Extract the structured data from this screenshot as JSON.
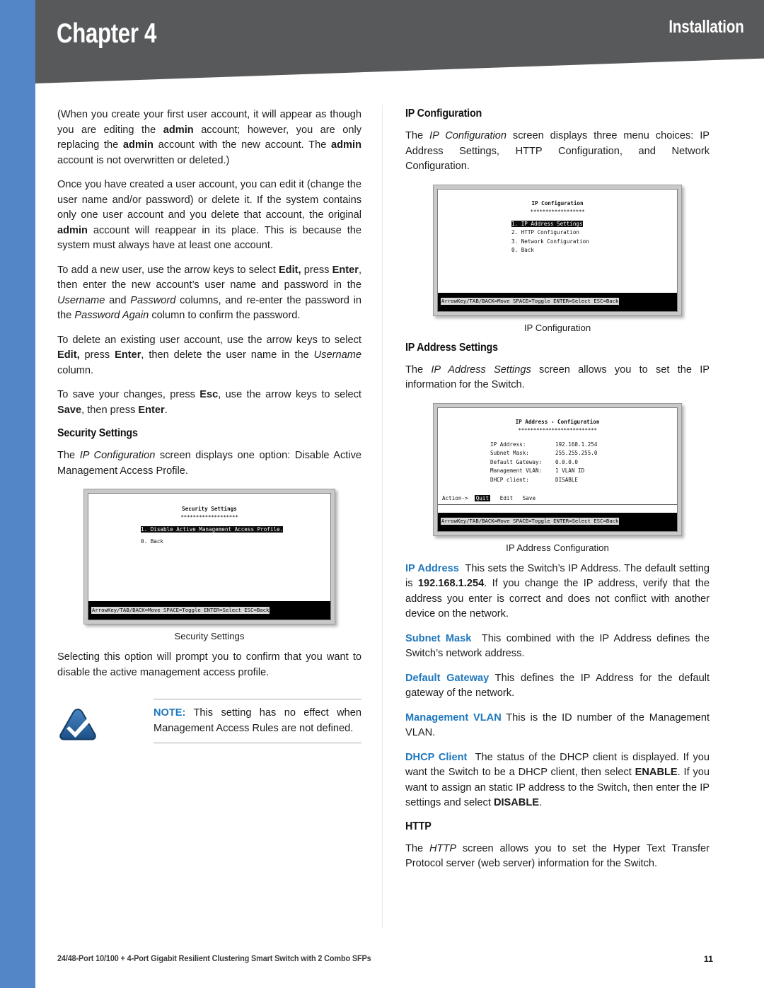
{
  "header": {
    "chapter": "Chapter 4",
    "section": "Installation"
  },
  "left_column": {
    "paragraphs": [
      {
        "id": "p1",
        "html": "(When you create your first user account, it will appear as though you are editing the <b>admin</b> account; however, you are only replacing the <b>admin</b> account with the new account. The <b>admin</b> account is not overwritten or deleted.)"
      },
      {
        "id": "p2",
        "html": "Once you have created a user account, you can edit it (change the user name and/or password) or delete it. If the system contains only one user account and you delete that account, the original <b>admin</b> account will reappear in its place. This is because the system must always have at least one account."
      },
      {
        "id": "p3",
        "html": "To add a new user, use the arrow keys to select <b>Edit,</b> press <b>Enter</b>, then enter the new account&rsquo;s user name and password in the <i>Username</i> and <i>Password</i> columns, and re-enter the password in the <i>Password Again</i> column to confirm the password."
      },
      {
        "id": "p4",
        "html": "To delete an existing user account, use the arrow keys to select <b>Edit,</b> press <b>Enter</b>, then delete the user name in the <i>Username</i> column."
      },
      {
        "id": "p5",
        "html": "To save your changes, press <b>Esc</b>, use the arrow keys to select <b>Save</b>, then press <b>Enter</b>."
      }
    ],
    "security_heading": "Security Settings",
    "security_intro": "The <i>IP Configuration</i> screen displays one option: Disable Active Management Access Profile.",
    "security_shot": {
      "title": "Security Settings",
      "rule": "*******************",
      "items": [
        {
          "text": "1. Disable Active Management Access Profile.",
          "highlighted": true
        },
        {
          "text": "0. Back",
          "highlighted": false
        }
      ],
      "status_bar": "ArrowKey/TAB/BACK=Move  SPACE=Toggle  ENTER=Select  ESC=Back",
      "caption": "Security Settings"
    },
    "after_shot": "Selecting this option will prompt you to confirm that you want to disable the active management access profile.",
    "note": {
      "keyword": "NOTE:",
      "text": " This setting has no effect when Management Access Rules are not defined.",
      "icon": "linksys-check-triangle-icon",
      "icon_color": "#2d6ca8"
    }
  },
  "right_column": {
    "ipconfig_heading": "IP Configuration",
    "ipconfig_intro": "The <i>IP Configuration</i> screen displays three menu choices: IP Address Settings, HTTP Configuration, and Network Configuration.",
    "ipconfig_shot": {
      "title": "IP Configuration",
      "rule": "******************",
      "items": [
        {
          "text": "1. IP Address Settings",
          "highlighted": true
        },
        {
          "text": "2. HTTP Configuration",
          "highlighted": false
        },
        {
          "text": "3. Network Configuration",
          "highlighted": false
        },
        {
          "text": "0. Back",
          "highlighted": false
        }
      ],
      "status_bar": "ArrowKey/TAB/BACK=Move  SPACE=Toggle  ENTER=Select  ESC=Back",
      "caption": "IP Configuration"
    },
    "ipaddr_heading": "IP Address Settings",
    "ipaddr_intro": "The <i>IP Address Settings</i> screen allows you to set the IP information for the Switch.",
    "ipaddr_shot": {
      "title": "IP Address - Configuration",
      "rule": "**************************",
      "fields": [
        {
          "key": "IP Address:",
          "value": "192.168.1.254"
        },
        {
          "key": "Subnet Mask:",
          "value": "255.255.255.0"
        },
        {
          "key": "Default Gateway:",
          "value": "0.0.0.0"
        },
        {
          "key": "Management VLAN:",
          "value": "1    VLAN ID"
        },
        {
          "key": "DHCP client:",
          "value": "DISABLE"
        }
      ],
      "action_label": "Action->",
      "action_items": [
        {
          "text": "Quit",
          "highlighted": true
        },
        {
          "text": "Edit",
          "highlighted": false
        },
        {
          "text": "Save",
          "highlighted": false
        }
      ],
      "status_bar": "ArrowKey/TAB/BACK=Move  SPACE=Toggle  ENTER=Select  ESC=Back",
      "caption": "IP Address Configuration"
    },
    "definitions": [
      {
        "term": "IP Address",
        "html": "<span class=\"term\">IP Address</span>&nbsp; This sets the Switch&rsquo;s IP Address. The default setting is <b>192.168.1.254</b>. If you change the IP address, verify that the address you enter is correct and does not conflict with another device on the network."
      },
      {
        "term": "Subnet Mask",
        "html": "<span class=\"term\">Subnet Mask</span>&nbsp; This combined with the IP Address defines the Switch&rsquo;s network address."
      },
      {
        "term": "Default Gateway",
        "html": "<span class=\"term\">Default Gateway</span> This defines the IP Address for the default gateway of the network."
      },
      {
        "term": "Management VLAN",
        "html": "<span class=\"term\">Management VLAN</span> This is the ID number of the Management VLAN."
      },
      {
        "term": "DHCP Client",
        "html": "<span class=\"term\">DHCP Client</span>&nbsp; The status of the DHCP client is displayed. If you want the Switch to be a DHCP client, then select <b>ENABLE</b>. If you want to assign an static IP address to the Switch, then enter the IP settings and select <b>DISABLE</b>."
      }
    ],
    "http_heading": "HTTP",
    "http_intro": "The <i>HTTP</i> screen allows you to set the Hyper Text Transfer Protocol server (web server) information for the Switch."
  },
  "footer": {
    "product": "24/48-Port 10/100 + 4-Port Gigabit Resilient Clustering Smart Switch with 2 Combo SFPs",
    "page_number": "11"
  },
  "colors": {
    "spine_blue": "#5386c6",
    "header_gray": "#58595b",
    "term_blue": "#2077bc"
  }
}
